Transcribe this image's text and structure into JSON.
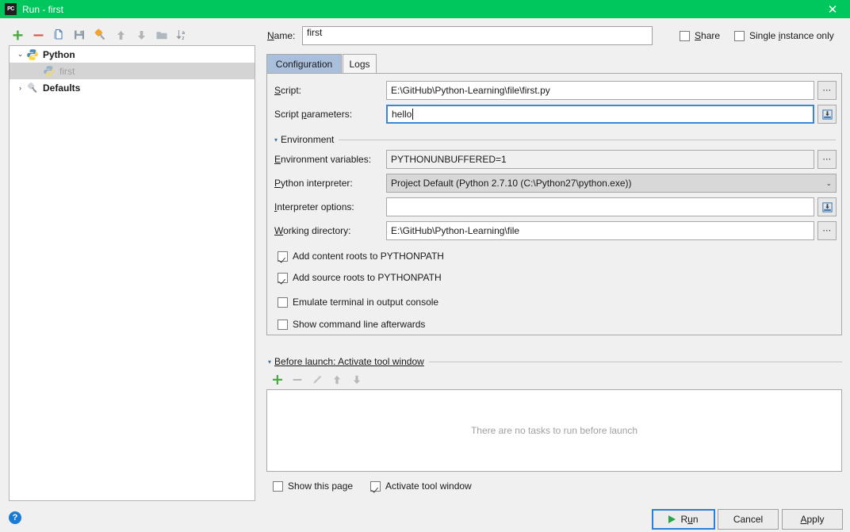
{
  "window": {
    "title": "Run - first",
    "app_icon": "pycharm-icon",
    "titlebar_color": "#00c65e",
    "close_label": "✕"
  },
  "toolbar": {
    "buttons": [
      {
        "name": "add-configuration-button",
        "icon": "plus-icon",
        "tooltip": "Add New Configuration"
      },
      {
        "name": "remove-configuration-button",
        "icon": "minus-icon",
        "tooltip": "Remove Configuration"
      },
      {
        "name": "copy-configuration-button",
        "icon": "copy-icon",
        "tooltip": "Copy Configuration"
      },
      {
        "name": "save-configuration-button",
        "icon": "save-icon",
        "tooltip": "Save Configuration"
      },
      {
        "name": "edit-defaults-button",
        "icon": "wrench-gear-icon",
        "tooltip": "Edit defaults"
      },
      {
        "name": "move-up-button",
        "icon": "arrow-up-icon",
        "tooltip": "Move Up"
      },
      {
        "name": "move-down-button",
        "icon": "arrow-down-icon",
        "tooltip": "Move Down"
      },
      {
        "name": "create-folder-button",
        "icon": "folder-icon",
        "tooltip": "Create New Folder"
      },
      {
        "name": "sort-alphabetically-button",
        "icon": "sort-az-icon",
        "tooltip": "Sort Configurations"
      }
    ]
  },
  "tree": {
    "items": [
      {
        "label": "Python",
        "icon": "python-logo-icon",
        "level": 0,
        "twisty": "⌄",
        "expanded": true,
        "bold": true,
        "selected": false,
        "dim": false
      },
      {
        "label": "first",
        "icon": "python-file-icon",
        "level": 1,
        "twisty": "",
        "expanded": false,
        "bold": false,
        "selected": true,
        "dim": true
      },
      {
        "label": "Defaults",
        "icon": "wrench-gear-icon",
        "level": 0,
        "twisty": "›",
        "expanded": false,
        "bold": true,
        "selected": false,
        "dim": false
      }
    ]
  },
  "name_row": {
    "label": "Name:",
    "value": "first",
    "placeholder": "",
    "share": {
      "label_pre": "",
      "label_accel": "S",
      "label_post": "hare",
      "checked": false
    },
    "single_instance": {
      "label_pre": "Single ",
      "label_accel": "i",
      "label_post": "nstance only",
      "checked": false
    }
  },
  "tabs": [
    {
      "label": "Configuration",
      "active": true
    },
    {
      "label": "Logs",
      "active": false
    }
  ],
  "configuration": {
    "script": {
      "label_pre": "",
      "label_accel": "S",
      "label_post": "cript:",
      "value": "E:\\GitHub\\Python-Learning\\file\\first.py",
      "browse_icon": "ellipsis-icon"
    },
    "script_parameters": {
      "label_pre": "Script ",
      "label_accel": "p",
      "label_post": "arameters:",
      "value": "hello",
      "focused": true,
      "expand_icon": "insert-macro-icon"
    },
    "environment_group": {
      "label": "Environment",
      "triangle": "▾",
      "expanded": true
    },
    "environment_variables": {
      "label_pre": "",
      "label_accel": "E",
      "label_post": "nvironment variables:",
      "value": "PYTHONUNBUFFERED=1",
      "browse_icon": "ellipsis-icon"
    },
    "python_interpreter": {
      "label_pre": "",
      "label_accel": "P",
      "label_post": "ython interpreter:",
      "value": "Project Default (Python 2.7.10 (C:\\Python27\\python.exe))",
      "arrow": "⌄"
    },
    "interpreter_options": {
      "label_pre": "",
      "label_accel": "I",
      "label_post": "nterpreter options:",
      "value": "",
      "expand_icon": "insert-macro-icon"
    },
    "working_directory": {
      "label_pre": "",
      "label_accel": "W",
      "label_post": "orking directory:",
      "value": "E:\\GitHub\\Python-Learning\\file",
      "browse_icon": "ellipsis-icon"
    },
    "checkboxes": [
      {
        "name": "add-content-roots-checkbox",
        "label": "Add content roots to PYTHONPATH",
        "checked": true
      },
      {
        "name": "add-source-roots-checkbox",
        "label": "Add source roots to PYTHONPATH",
        "checked": true
      },
      {
        "name": "emulate-terminal-checkbox",
        "label": "Emulate terminal in output console",
        "checked": false
      },
      {
        "name": "show-command-line-checkbox",
        "label": "Show command line afterwards",
        "checked": false
      }
    ]
  },
  "before_launch": {
    "triangle": "▾",
    "label_pre": "",
    "label_accel": "B",
    "label_post": "efore launch: Activate tool window",
    "toolbar": [
      {
        "name": "add-task-button",
        "icon": "plus-icon",
        "enabled": true
      },
      {
        "name": "remove-task-button",
        "icon": "minus-icon",
        "enabled": false
      },
      {
        "name": "edit-task-button",
        "icon": "pencil-icon",
        "enabled": false
      },
      {
        "name": "move-task-up-button",
        "icon": "arrow-up-icon",
        "enabled": false
      },
      {
        "name": "move-task-down-button",
        "icon": "arrow-down-icon",
        "enabled": false
      }
    ],
    "empty_text": "There are no tasks to run before launch",
    "show_this_page": {
      "label": "Show this page",
      "checked": false
    },
    "activate_tool_window": {
      "label": "Activate tool window",
      "checked": true
    }
  },
  "footer": {
    "help_icon": "help-question-icon",
    "help_glyph": "?",
    "run_button": {
      "label_pre": "R",
      "label_accel": "u",
      "label_post": "n",
      "icon": "play-triangle-icon",
      "focused": true
    },
    "cancel_button": {
      "label": "Cancel"
    },
    "apply_button": {
      "label_pre": "",
      "label_accel": "A",
      "label_post": "pply"
    }
  },
  "colors": {
    "title_green": "#00c65e",
    "tab_active": "#a9bfdc",
    "focus_blue": "#3d86d4",
    "accent_green": "#27a744",
    "help_blue": "#1a7bd4"
  }
}
